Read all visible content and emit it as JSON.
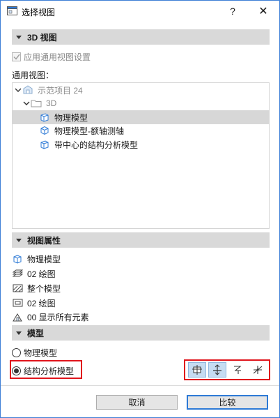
{
  "window": {
    "title": "选择视图",
    "help_label": "?",
    "close_label": "✕"
  },
  "view3d": {
    "section_title": "3D 视图",
    "apply_checkbox_label": "应用通用视图设置",
    "apply_checked": true,
    "general_views_label": "通用视图：",
    "tree": [
      {
        "label": "示范项目 24",
        "level": 0,
        "icon": "project-icon",
        "expanded": true,
        "muted": true
      },
      {
        "label": "3D",
        "level": 1,
        "icon": "folder-icon",
        "expanded": true,
        "muted": true
      },
      {
        "label": "物理模型",
        "level": 2,
        "icon": "view-3d-icon",
        "selected": true
      },
      {
        "label": "物理模型-额轴测轴",
        "level": 2,
        "icon": "axon-icon"
      },
      {
        "label": "带中心的结构分析模型",
        "level": 2,
        "icon": "view-3d-icon"
      }
    ]
  },
  "properties": {
    "section_title": "视图属性",
    "items": [
      {
        "label": "物理模型",
        "icon": "model-icon"
      },
      {
        "label": "02 绘图",
        "icon": "layer-icon"
      },
      {
        "label": "整个模型",
        "icon": "filter-icon"
      },
      {
        "label": "02 绘图",
        "icon": "pen-set-icon"
      },
      {
        "label": "00 显示所有元素",
        "icon": "renovation-icon"
      }
    ]
  },
  "model": {
    "section_title": "模型",
    "options": [
      {
        "label": "物理模型",
        "selected": false
      },
      {
        "label": "结构分析模型",
        "selected": true
      }
    ],
    "tools": [
      "surface-icon",
      "center-axis-icon",
      "analytic-icon",
      "mesh-icon"
    ]
  },
  "footer": {
    "cancel_label": "取消",
    "compare_label": "比较"
  },
  "colors": {
    "accent": "#2d7ad6",
    "highlight": "#e0141b",
    "selection": "#d7d7d7",
    "section_bg": "#d9d9d9"
  }
}
